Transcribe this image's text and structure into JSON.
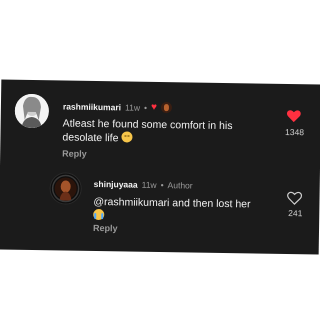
{
  "comment": {
    "username": "rashmiikumari",
    "age": "11w",
    "dot": "•",
    "text": "Atleast he found some comfort in his desolate life",
    "emoji": "sad-face-icon",
    "reply_label": "Reply",
    "like_count": "1348",
    "liked": true,
    "like_color": "#ff3040"
  },
  "reply": {
    "username": "shinjuyaaa",
    "age": "11w",
    "dot": "•",
    "author_badge": "Author",
    "text": "@rashmiikumari and then lost her",
    "emoji": "crying-face-icon",
    "reply_label": "Reply",
    "like_count": "241",
    "liked": false
  },
  "colors": {
    "background": "#1b1b1b",
    "muted_text": "#9a9a9a",
    "like_red": "#ff3040"
  }
}
